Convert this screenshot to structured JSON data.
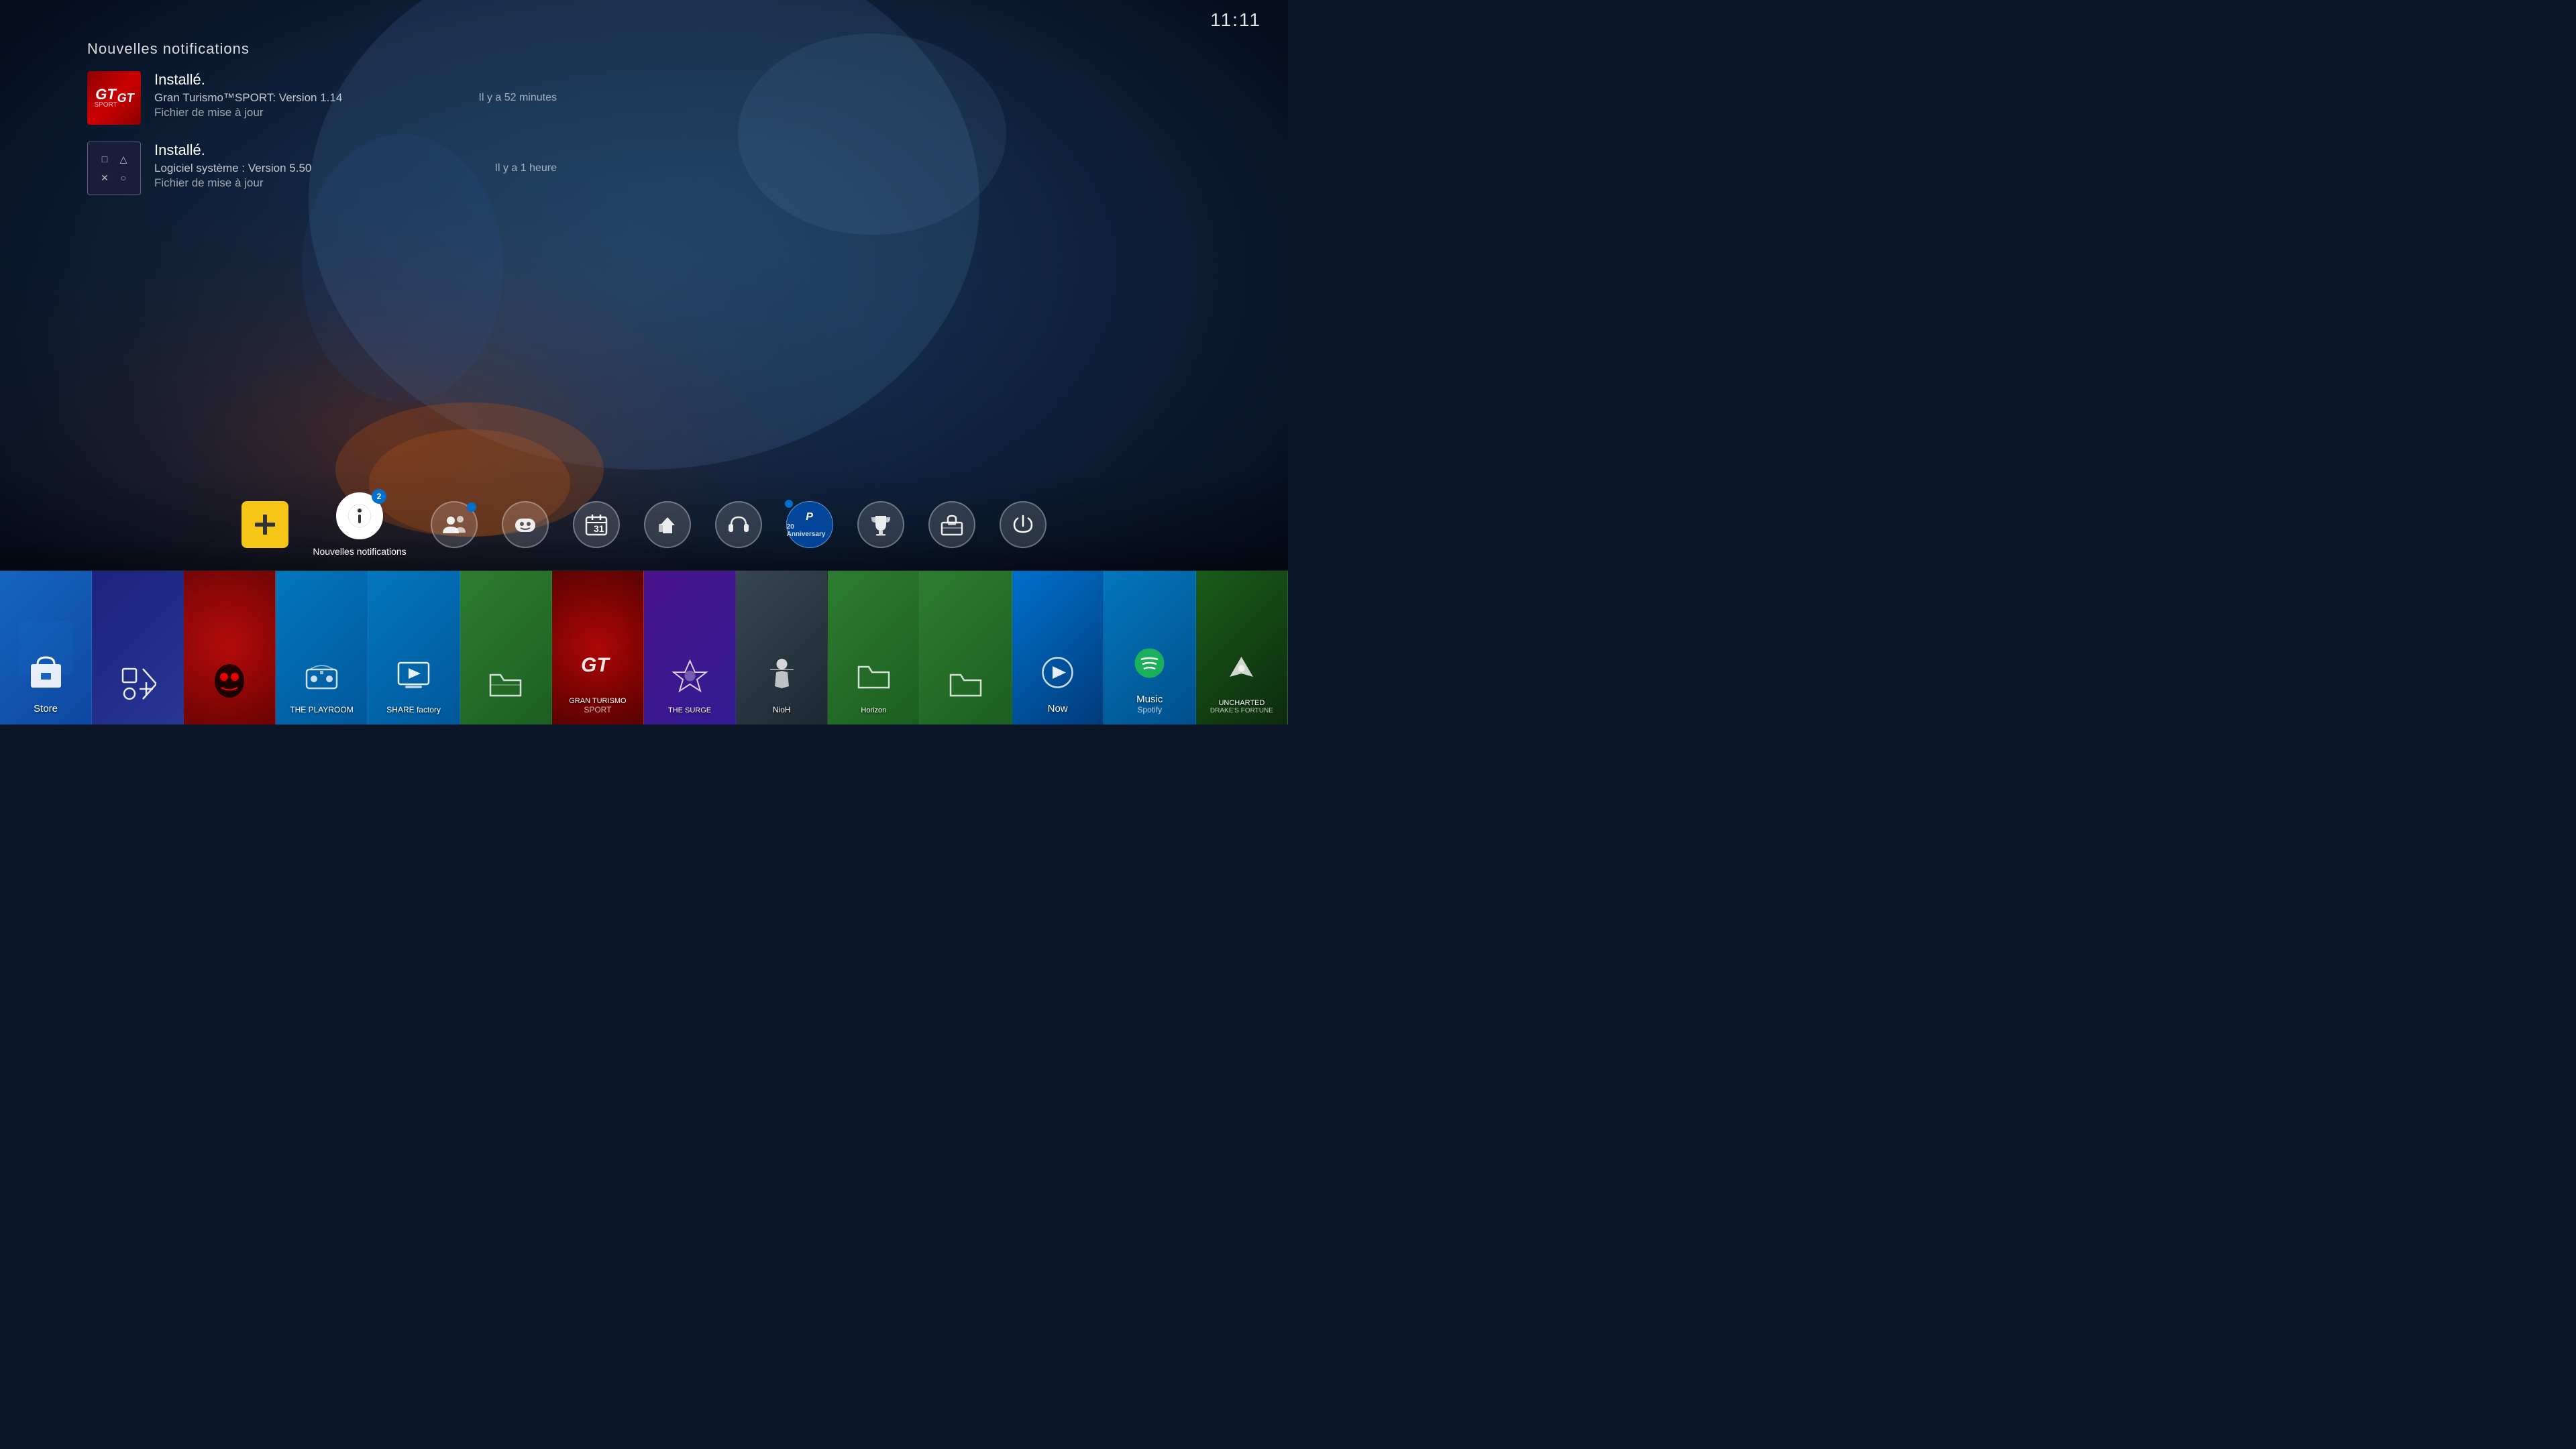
{
  "clock": "11:11",
  "notifications": {
    "section_title": "Nouvelles notifications",
    "items": [
      {
        "id": "gt_update",
        "title": "Installé.",
        "subtitle": "Gran Turismo™SPORT: Version 1.14",
        "detail": "Fichier de mise à jour",
        "time": "Il y a 52 minutes",
        "icon_type": "gt"
      },
      {
        "id": "system_update",
        "title": "Installé.",
        "subtitle": "Logiciel système : Version 5.50",
        "detail": "Fichier de mise à jour",
        "time": "Il y a 1 heure",
        "icon_type": "ps"
      }
    ]
  },
  "function_bar": {
    "items": [
      {
        "id": "psplus",
        "label": "",
        "icon": "psplus",
        "badge": ""
      },
      {
        "id": "notifications",
        "label": "Notifications",
        "icon": "info",
        "badge": "2",
        "badge_type": "number",
        "selected": true
      },
      {
        "id": "friends",
        "label": "",
        "icon": "friends",
        "badge": "1",
        "badge_type": "dot"
      },
      {
        "id": "avatars",
        "label": "",
        "icon": "avatars",
        "badge": ""
      },
      {
        "id": "calendar",
        "label": "",
        "icon": "calendar",
        "badge": ""
      },
      {
        "id": "feedback",
        "label": "",
        "icon": "feedback",
        "badge": ""
      },
      {
        "id": "headset",
        "label": "",
        "icon": "headset",
        "badge": ""
      },
      {
        "id": "anniversary",
        "label": "",
        "icon": "anniversary",
        "badge": "dot"
      },
      {
        "id": "trophy",
        "label": "",
        "icon": "trophy",
        "badge": ""
      },
      {
        "id": "toolbox",
        "label": "",
        "icon": "toolbox",
        "badge": ""
      },
      {
        "id": "power",
        "label": "",
        "icon": "power",
        "badge": ""
      }
    ]
  },
  "game_bar": {
    "tiles": [
      {
        "id": "store",
        "label": "Store",
        "sub_label": "",
        "color": "store",
        "icon": "🛍️"
      },
      {
        "id": "ps_menu",
        "label": "",
        "sub_label": "",
        "color": "ps",
        "icon": "ps_shapes"
      },
      {
        "id": "persona5",
        "label": "",
        "sub_label": "",
        "color": "persona5",
        "icon": "P5"
      },
      {
        "id": "playroom",
        "label": "THE PLAYROOM",
        "sub_label": "",
        "color": "playroom",
        "icon": ""
      },
      {
        "id": "share_factory",
        "label": "SHARE factory",
        "sub_label": "",
        "color": "share",
        "icon": "🎬"
      },
      {
        "id": "folder1",
        "label": "",
        "sub_label": "",
        "color": "folder1",
        "icon": "📁"
      },
      {
        "id": "gran_turismo",
        "label": "GRAN TURISMO",
        "sub_label": "SPORT",
        "color": "gt",
        "icon": "GT"
      },
      {
        "id": "the_surge",
        "label": "THE SURGE",
        "sub_label": "",
        "color": "surge",
        "icon": "⚡"
      },
      {
        "id": "nioh",
        "label": "NioH",
        "sub_label": "",
        "color": "nioh",
        "icon": "⚔️"
      },
      {
        "id": "horizon",
        "label": "Horizon",
        "sub_label": "",
        "color": "folder2",
        "icon": "📁"
      },
      {
        "id": "folder2",
        "label": "",
        "sub_label": "",
        "color": "folder2",
        "icon": "📁"
      },
      {
        "id": "ps_now",
        "label": "Now",
        "sub_label": "",
        "color": "psmusic",
        "icon": "🎮"
      },
      {
        "id": "ps_music",
        "label": "Music",
        "sub_label": "Spotify",
        "color": "psmusic",
        "icon": "🎵"
      },
      {
        "id": "uncharted",
        "label": "UNCHARTED",
        "sub_label": "DRAKE'S FORTUNE",
        "color": "uncharted",
        "icon": "🗺️"
      }
    ]
  },
  "icons": {
    "info": "ℹ",
    "friends": "😊",
    "avatars": "🎮",
    "calendar": "📅",
    "feedback": "👍",
    "headset": "🎧",
    "trophy": "🏆",
    "power": "⏻",
    "toolbox": "🧰",
    "anniversary_label": "20",
    "anniversary_sub": "Anniversary"
  }
}
